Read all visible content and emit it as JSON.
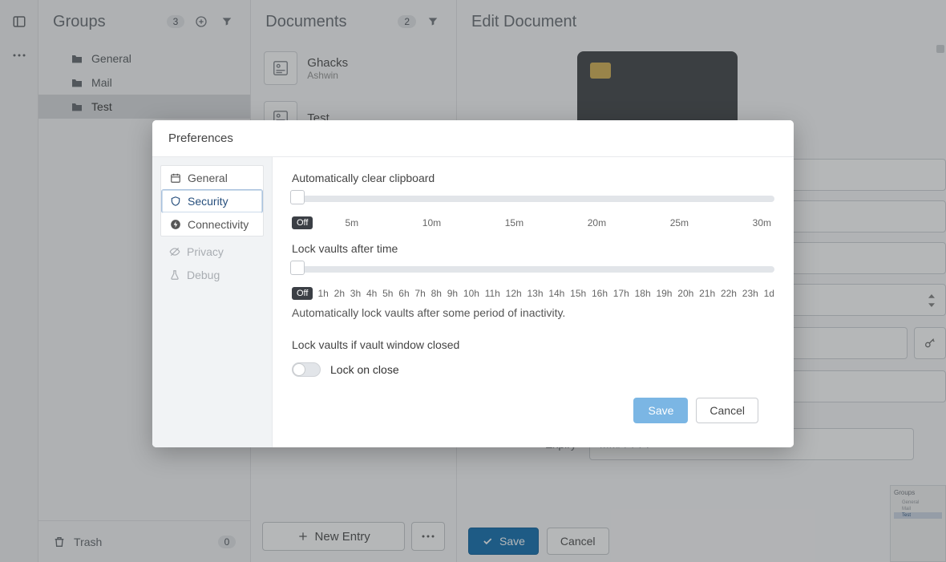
{
  "rail": {
    "icon1": "panel-icon",
    "icon2": "more-icon"
  },
  "groups": {
    "title": "Groups",
    "count": "3",
    "items": [
      {
        "label": "General"
      },
      {
        "label": "Mail"
      },
      {
        "label": "Test",
        "selected": true
      }
    ],
    "trash_label": "Trash",
    "trash_count": "0"
  },
  "documents": {
    "title": "Documents",
    "count": "2",
    "items": [
      {
        "title": "Ghacks",
        "sub": "Ashwin"
      },
      {
        "title": "Test",
        "sub": ""
      }
    ],
    "new_entry_label": "New Entry"
  },
  "edit": {
    "title": "Edit Document",
    "expiry_label": "Expiry",
    "expiry_placeholder": "MM/YYYY",
    "save_label": "Save",
    "cancel_label": "Cancel"
  },
  "modal": {
    "title": "Preferences",
    "tabs": {
      "general": "General",
      "security": "Security",
      "connectivity": "Connectivity",
      "privacy": "Privacy",
      "debug": "Debug"
    },
    "clipboard": {
      "label": "Automatically clear clipboard",
      "off": "Off",
      "ticks": [
        "5m",
        "10m",
        "15m",
        "20m",
        "25m",
        "30m"
      ]
    },
    "lock_time": {
      "label": "Lock vaults after time",
      "off": "Off",
      "ticks": [
        "1h",
        "2h",
        "3h",
        "4h",
        "5h",
        "6h",
        "7h",
        "8h",
        "9h",
        "10h",
        "11h",
        "12h",
        "13h",
        "14h",
        "15h",
        "16h",
        "17h",
        "18h",
        "19h",
        "20h",
        "21h",
        "22h",
        "23h",
        "1d"
      ],
      "help": "Automatically lock vaults after some period of inactivity."
    },
    "lock_close": {
      "label": "Lock vaults if vault window closed",
      "toggle_label": "Lock on close",
      "value": false
    },
    "save_label": "Save",
    "cancel_label": "Cancel"
  },
  "mini": {
    "title": "Groups",
    "items": [
      "General",
      "Mail",
      "Test"
    ]
  }
}
